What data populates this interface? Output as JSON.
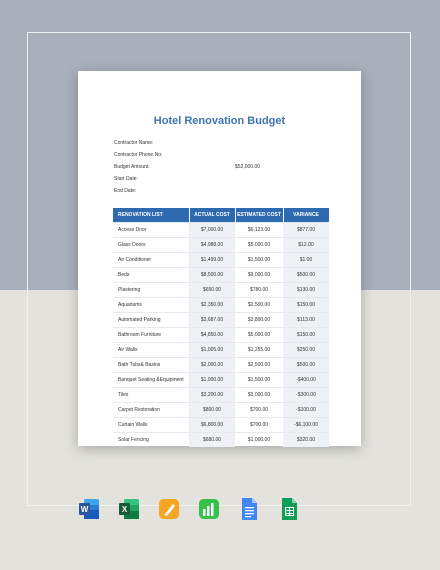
{
  "document": {
    "title": "Hotel Renovation Budget",
    "info": [
      {
        "label": "Contractor Name:",
        "value": ""
      },
      {
        "label": "Contractor Phone No:",
        "value": ""
      },
      {
        "label": "Budget Amount:",
        "value": "$52,000.00"
      },
      {
        "label": "Start Date:",
        "value": ""
      },
      {
        "label": "End Date:",
        "value": ""
      }
    ],
    "table": {
      "headers": [
        "RENOVATION LIST",
        "ACTUAL COST",
        "ESTIMATED COST",
        "VARIANCE"
      ],
      "rows": [
        [
          "Access Door",
          "$7,000.00",
          "$6,123.00",
          "$877.00"
        ],
        [
          "Glass Doors",
          "$4,988.00",
          "$5,000.00",
          "$12.00"
        ],
        [
          "Air Conditioner",
          "$1,499.00",
          "$1,500.00",
          "$1.00"
        ],
        [
          "Beds",
          "$8,500.00",
          "$9,000.00",
          "$500.00"
        ],
        [
          "Plastering",
          "$650.00",
          "$780.00",
          "$130.00"
        ],
        [
          "Aquariums",
          "$2,350.00",
          "$2,500.00",
          "$150.00"
        ],
        [
          "Automated Parking",
          "$3,687.00",
          "$3,800.00",
          "$113.00"
        ],
        [
          "Bathroom Furniture",
          "$4,850.00",
          "$5,000.00",
          "$150.00"
        ],
        [
          "Air Walls",
          "$1,005.00",
          "$1,255.00",
          "$250.00"
        ],
        [
          "Bath Tubs& Basins",
          "$2,000.00",
          "$2,500.00",
          "$500.00"
        ],
        [
          "Banquet Seating &Equipment",
          "$1,900.00",
          "$1,500.00",
          "-$400.00"
        ],
        [
          "Tiles",
          "$3,200.00",
          "$3,000.00",
          "-$300.00"
        ],
        [
          "Carpet Restoration",
          "$800.00",
          "$700.00",
          "-$100.00"
        ],
        [
          "Curtain Walls",
          "$6,800.00",
          "$700.00",
          "-$6,100.00"
        ],
        [
          "Solar Fencing",
          "$680.00",
          "$1,000.00",
          "$320.00"
        ]
      ]
    }
  },
  "app_icons": [
    {
      "name": "word-icon",
      "letter": "W",
      "color": "#2b579a"
    },
    {
      "name": "excel-icon",
      "letter": "X",
      "color": "#217346"
    },
    {
      "name": "pages-icon",
      "letter": "",
      "color": "#f5a623"
    },
    {
      "name": "numbers-icon",
      "letter": "",
      "color": "#36c24a"
    },
    {
      "name": "google-docs-icon",
      "letter": "",
      "color": "#4285f4"
    },
    {
      "name": "google-sheets-icon",
      "letter": "",
      "color": "#0f9d58"
    }
  ]
}
